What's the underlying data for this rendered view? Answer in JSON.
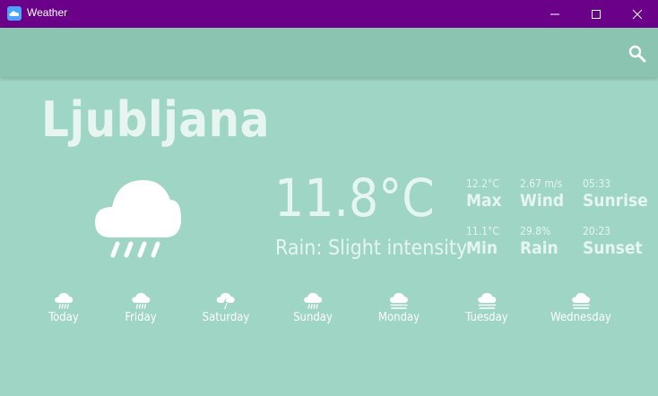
{
  "window": {
    "title": "Weather"
  },
  "toolbar": {
    "search_icon": "search-icon"
  },
  "city": "Ljubljana",
  "current": {
    "temperature": "11.8°C",
    "condition": "Rain: Slight intensity",
    "icon": "rain-cloud-icon"
  },
  "stats": {
    "max": {
      "value": "12.2°C",
      "label": "Max"
    },
    "min": {
      "value": "11.1°C",
      "label": "Min"
    },
    "wind": {
      "value": "2.67 m/s",
      "label": "Wind"
    },
    "rain": {
      "value": "29.8%",
      "label": "Rain"
    },
    "sunrise": {
      "value": "05:33",
      "label": "Sunrise"
    },
    "sunset": {
      "value": "20:23",
      "label": "Sunset"
    }
  },
  "forecast": [
    {
      "day": "Today",
      "icon": "rain-cloud-icon"
    },
    {
      "day": "Friday",
      "icon": "rain-cloud-icon"
    },
    {
      "day": "Saturday",
      "icon": "thunderstorm-icon"
    },
    {
      "day": "Sunday",
      "icon": "rain-cloud-icon"
    },
    {
      "day": "Monday",
      "icon": "fog-cloud-icon"
    },
    {
      "day": "Tuesday",
      "icon": "fog-cloud-icon"
    },
    {
      "day": "Wednesday",
      "icon": "fog-cloud-icon"
    }
  ],
  "colors": {
    "titlebar": "#6b0089",
    "background": "#9ed5c5",
    "toolbar": "#8bc5b2",
    "text": "#e6f5f0"
  }
}
